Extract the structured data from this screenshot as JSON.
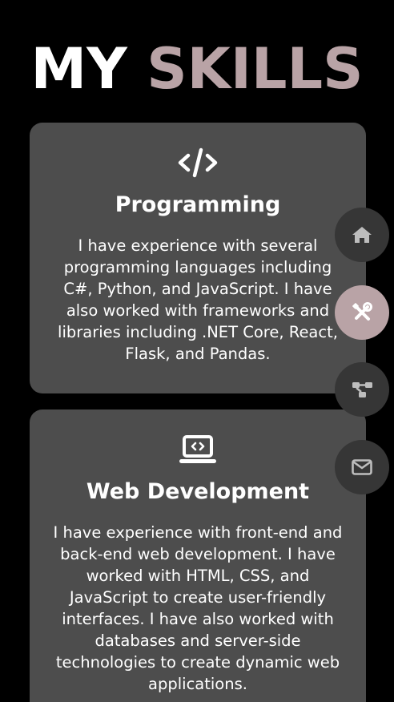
{
  "header": {
    "title_first": "MY",
    "title_second": "SKILLS"
  },
  "colors": {
    "background": "#000000",
    "card": "#4d4d4d",
    "accent": "#b9a3a6",
    "nav_inactive": "#363636",
    "text": "#ffffff"
  },
  "skills": [
    {
      "icon": "code-icon",
      "title": "Programming",
      "description": "I have experience with several programming languages including C#, Python, and JavaScript. I have also worked with frameworks and libraries including .NET Core, React, Flask, and Pandas."
    },
    {
      "icon": "laptop-code-icon",
      "title": "Web Development",
      "description": "I have experience with front-end and back-end web development. I have worked with HTML, CSS, and JavaScript to create user-friendly interfaces. I have also worked with databases and server-side technologies to create dynamic web applications."
    }
  ],
  "side_nav": [
    {
      "icon": "home-icon",
      "active": false
    },
    {
      "icon": "tools-icon",
      "active": true
    },
    {
      "icon": "sitemap-icon",
      "active": false
    },
    {
      "icon": "envelope-icon",
      "active": false
    }
  ]
}
